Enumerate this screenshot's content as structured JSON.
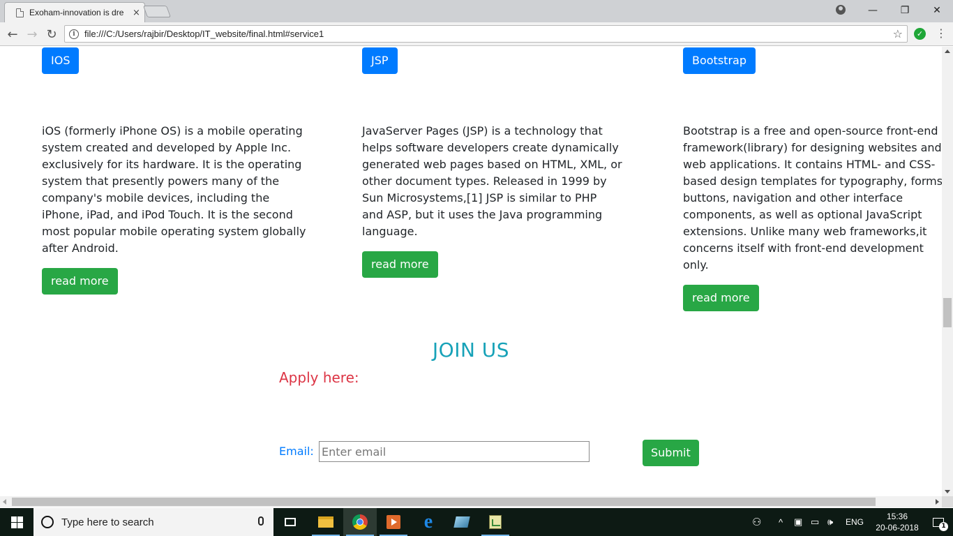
{
  "browser": {
    "tab_title": "Exoham-innovation is dre",
    "tab_close": "×",
    "url": "file:///C:/Users/rajbir/Desktop/IT_website/final.html#service1",
    "window_controls": {
      "minimize": "—",
      "maximize": "❐",
      "close": "✕"
    },
    "nav": {
      "back": "←",
      "forward": "→",
      "reload": "↻"
    },
    "star": "☆",
    "menu": "⋮",
    "extension_mark": "✓"
  },
  "services": [
    {
      "tag": "IOS",
      "description": "iOS (formerly iPhone OS) is a mobile operating system created and developed by Apple Inc. exclusively for its hardware. It is the operating system that presently powers many of the company's mobile devices, including the iPhone, iPad, and iPod Touch. It is the second most popular mobile operating system globally after Android.",
      "lines": [
        "iOS (formerly iPhone OS) is a mobile operating",
        "system created and developed by Apple Inc.",
        "exclusively for its hardware. It is the operating",
        "system that presently powers many of the",
        "company's mobile devices, including the",
        "iPhone, iPad, and iPod Touch. It is the second",
        "most popular mobile operating system globally",
        "after Android."
      ],
      "button": "read more"
    },
    {
      "tag": "JSP",
      "lines": [
        "JavaServer Pages (JSP) is a technology that",
        "helps software developers create dynamically",
        "generated web pages based on HTML, XML, or",
        "other document types. Released in 1999 by",
        "Sun Microsystems,[1] JSP is similar to PHP",
        "and ASP, but it uses the Java programming",
        "language."
      ],
      "button": "read more"
    },
    {
      "tag": "Bootstrap",
      "lines": [
        "Bootstrap is a free and open-source front-end",
        "framework(library) for designing websites and",
        "web applications. It contains HTML- and CSS-",
        "based design templates for typography, forms,",
        "buttons, navigation and other interface",
        "components, as well as optional JavaScript",
        "extensions. Unlike many web frameworks,it",
        "concerns itself with front-end development",
        "only."
      ],
      "button": "read more"
    }
  ],
  "join": {
    "heading": "JOIN US",
    "apply_label": "Apply here:",
    "email_label": "Email:",
    "email_placeholder": "Enter email",
    "email_value": "",
    "submit": "Submit"
  },
  "taskbar": {
    "search_placeholder": "Type here to search",
    "apps": [
      "task-view",
      "file-explorer",
      "chrome",
      "media-player",
      "edge",
      "app-5",
      "app-6"
    ],
    "tray": {
      "people": "⚇",
      "chevron": "^",
      "language": "ENG"
    },
    "time": "15:36",
    "date": "20-06-2018",
    "notification_count": "1"
  },
  "colors": {
    "primary": "#007bff",
    "success": "#28a745",
    "info": "#17a2b8",
    "danger": "#dc3545",
    "taskbar": "#0d1a14"
  }
}
